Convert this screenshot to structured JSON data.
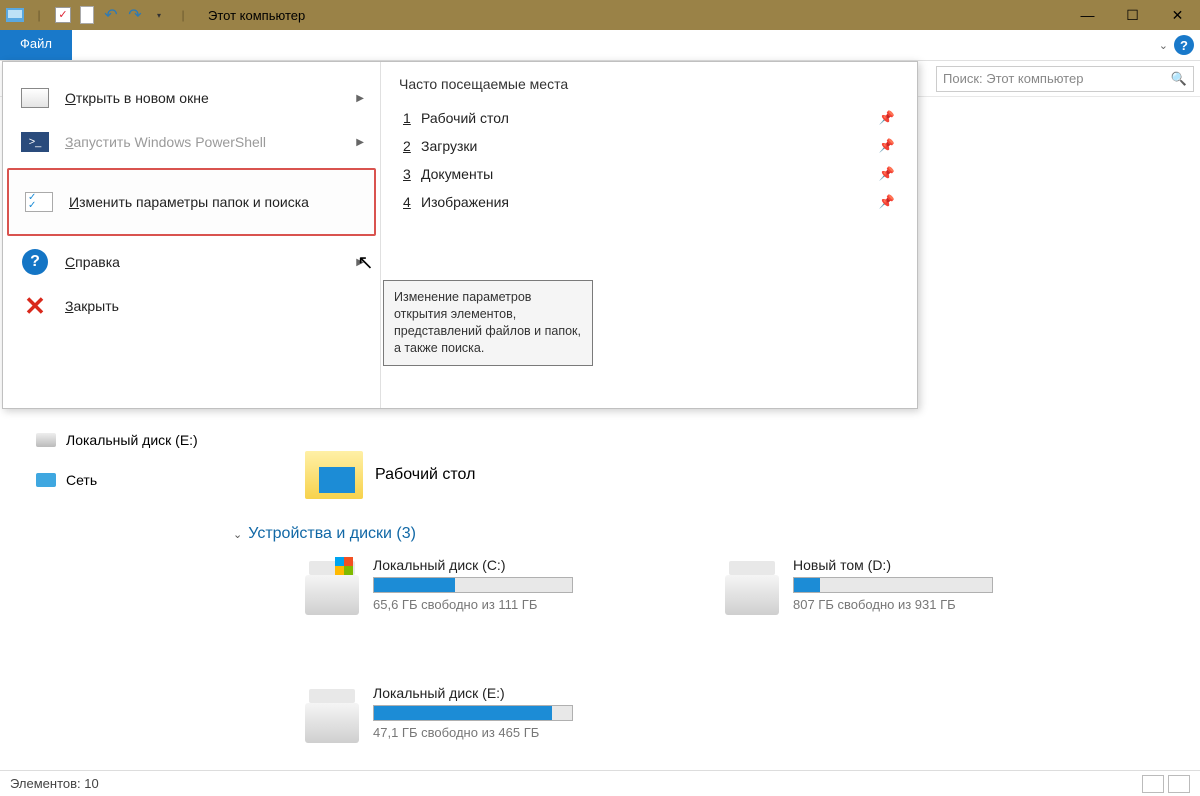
{
  "titlebar": {
    "title": "Этот компьютер",
    "minimize": "—",
    "maximize": "☐",
    "close": "✕"
  },
  "ribbon": {
    "file_tab": "Файл"
  },
  "search": {
    "placeholder": "Поиск: Этот компьютер"
  },
  "file_menu": {
    "items": {
      "open_new": "Открыть в новом окне",
      "powershell": "Запустить Windows PowerShell",
      "change_options": "Изменить параметры папок и поиска",
      "help": "Справка",
      "close": "Закрыть"
    },
    "freq_heading": "Часто посещаемые места",
    "places": [
      {
        "num": "1",
        "label": "Рабочий стол"
      },
      {
        "num": "2",
        "label": "Загрузки"
      },
      {
        "num": "3",
        "label": "Документы"
      },
      {
        "num": "4",
        "label": "Изображения"
      }
    ],
    "tooltip": "Изменение параметров открытия элементов, представлений файлов и папок, а также поиска."
  },
  "sidebar": {
    "disk_e": "Локальный диск (E:)",
    "network": "Сеть"
  },
  "main": {
    "desktop_folder": "Рабочий стол",
    "section": "Устройства и диски (3)",
    "drives": [
      {
        "name": "Локальный диск (C:)",
        "free_text": "65,6 ГБ свободно из 111 ГБ",
        "fill": 41
      },
      {
        "name": "Новый том (D:)",
        "free_text": "807 ГБ свободно из 931 ГБ",
        "fill": 13
      },
      {
        "name": "Локальный диск (E:)",
        "free_text": "47,1 ГБ свободно из 465 ГБ",
        "fill": 90
      }
    ]
  },
  "statusbar": {
    "elements": "Элементов: 10"
  }
}
